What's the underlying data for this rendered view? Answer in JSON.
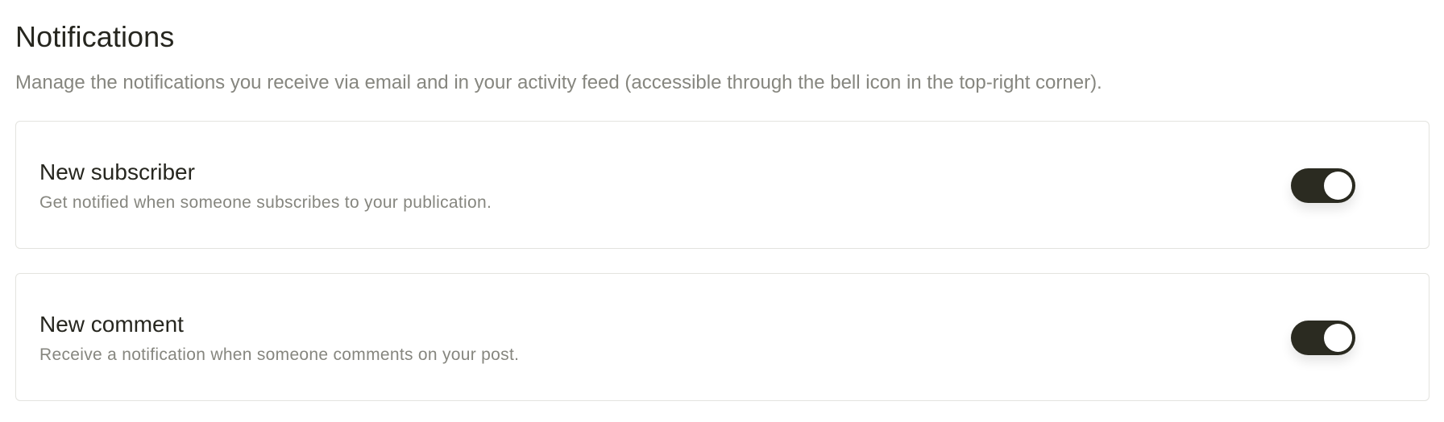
{
  "header": {
    "title": "Notifications",
    "subtitle": "Manage the notifications you receive via email and in your activity feed (accessible through the bell icon in the top-right corner)."
  },
  "settings": [
    {
      "title": "New subscriber",
      "description": "Get notified when someone subscribes to your publication.",
      "enabled": true
    },
    {
      "title": "New comment",
      "description": "Receive a notification when someone comments on your post.",
      "enabled": true
    }
  ],
  "colors": {
    "toggle_on": "#2b2b21",
    "text_primary": "#26261f",
    "text_secondary": "#86867f",
    "border": "#e3e3df"
  }
}
